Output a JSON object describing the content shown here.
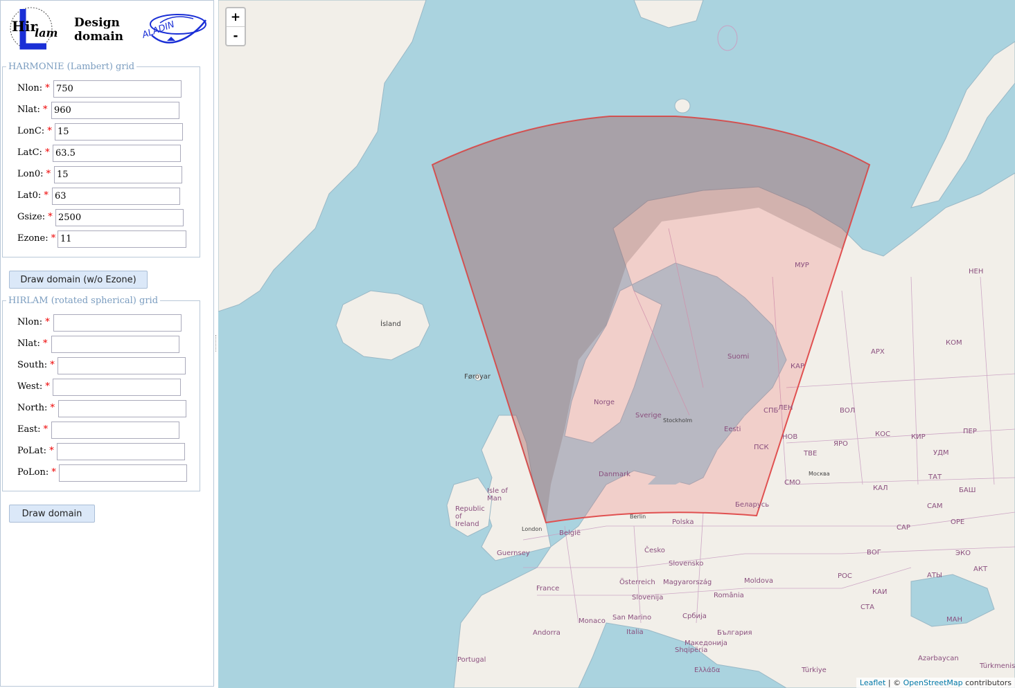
{
  "header": {
    "title_line1": "Design",
    "title_line2": "domain",
    "logo_left": "HIRLAM logo",
    "logo_right": "ALADIN logo"
  },
  "harmonie": {
    "legend": "HARMONIE (Lambert) grid",
    "fields": [
      {
        "label": "Nlon:",
        "value": "750"
      },
      {
        "label": "Nlat:",
        "value": "960"
      },
      {
        "label": "LonC:",
        "value": "15"
      },
      {
        "label": "LatC:",
        "value": "63.5"
      },
      {
        "label": "Lon0:",
        "value": "15"
      },
      {
        "label": "Lat0:",
        "value": "63"
      },
      {
        "label": "Gsize:",
        "value": "2500"
      },
      {
        "label": "Ezone:",
        "value": "11"
      }
    ],
    "button": "Draw domain (w/o Ezone)"
  },
  "hirlam": {
    "legend": "HIRLAM (rotated spherical) grid",
    "fields": [
      {
        "label": "Nlon:",
        "value": ""
      },
      {
        "label": "Nlat:",
        "value": ""
      },
      {
        "label": "South:",
        "value": ""
      },
      {
        "label": "West:",
        "value": ""
      },
      {
        "label": "North:",
        "value": ""
      },
      {
        "label": "East:",
        "value": ""
      },
      {
        "label": "PoLat:",
        "value": ""
      },
      {
        "label": "PoLon:",
        "value": ""
      }
    ],
    "button": "Draw domain"
  },
  "map": {
    "zoom_in": "+",
    "zoom_out": "-",
    "attribution_leaflet": "Leaflet",
    "attribution_sep": " | © ",
    "attribution_osm": "OpenStreetMap",
    "attribution_tail": " contributors",
    "labels": {
      "island": "Ísland",
      "foroyar": "Føroyar",
      "norge": "Norge",
      "sverige": "Sverige",
      "suomi": "Suomi",
      "eesti": "Eesti",
      "danmark": "Danmark",
      "belarus": "Беларусь",
      "polska": "Polska",
      "belgie": "België",
      "france": "France",
      "cesko": "Česko",
      "romania": "România",
      "republic_ireland": "Republic of Ireland",
      "isle_of_man": "Isle of Man",
      "london": "London",
      "berlin": "Berlin",
      "stockholm": "Stockholm",
      "moscow": "Москва",
      "slovensko": "Slovensko",
      "magyarorszag": "Magyarország",
      "osterreich": "Österreich",
      "slovenija": "Slovenija",
      "italia": "Italia",
      "portugal": "Portugal",
      "turkiye": "Türkiye",
      "moldova": "Moldova",
      "azerbaycan": "Azərbaycan",
      "turkmenistan": "Türkmenist",
      "guernsey": "Guernsey",
      "andorra": "Andorra",
      "san_marino": "San Marino",
      "monaco": "Monaco",
      "bulgaria": "България",
      "srbija": "Србија",
      "shqiperia": "Shqipëria",
      "ellada": "Ελλάδα",
      "makedonija": "Македонија",
      "mur": "МУР",
      "kar": "КАР",
      "len": "ЛЕН",
      "spb": "СПБ",
      "psk": "ПСК",
      "nov": "НОВ",
      "kom": "КОМ",
      "arkh": "АРХ",
      "nen": "НЕН",
      "vol": "ВОЛ",
      "yar": "ЯРО",
      "kos": "КОС",
      "kir": "КИР",
      "per": "ПЕР",
      "tve": "ТВЕ",
      "udm": "УДМ",
      "smo": "СМО",
      "tat": "ТАТ",
      "bash": "БАШ",
      "sam": "САМ",
      "ore": "ОРЕ",
      "sar": "САР",
      "vog": "ВОГ",
      "ros": "РОС",
      "kai": "КАИ",
      "sta": "СТА",
      "kal": "КАЛ",
      "aty": "АТЫ",
      "akt": "АКТ",
      "eko": "ЭКО",
      "man": "МАН"
    }
  }
}
